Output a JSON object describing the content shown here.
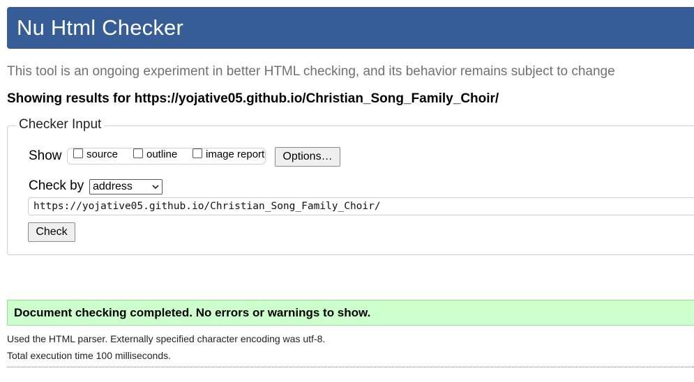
{
  "header": {
    "title": "Nu Html Checker",
    "background": "#365d95"
  },
  "subtitle": "This tool is an ongoing experiment in better HTML checking, and its behavior remains subject to change",
  "results": {
    "prefix": "Showing results for ",
    "url": "https://yojative05.github.io/Christian_Song_Family_Choir/"
  },
  "checker_input": {
    "legend": "Checker Input",
    "show_label": "Show",
    "show_options": [
      {
        "label": "source",
        "checked": false
      },
      {
        "label": "outline",
        "checked": false
      },
      {
        "label": "image report",
        "checked": false
      }
    ],
    "options_button": "Options…",
    "check_by_label": "Check by",
    "check_by_value": "address",
    "url_value": "https://yojative05.github.io/Christian_Song_Family_Choir/",
    "check_button": "Check"
  },
  "result_message": {
    "text": "Document checking completed. No errors or warnings to show.",
    "background": "#ccffcc"
  },
  "info": [
    "Used the HTML parser. Externally specified character encoding was utf-8.",
    "Total execution time 100 milliseconds."
  ]
}
